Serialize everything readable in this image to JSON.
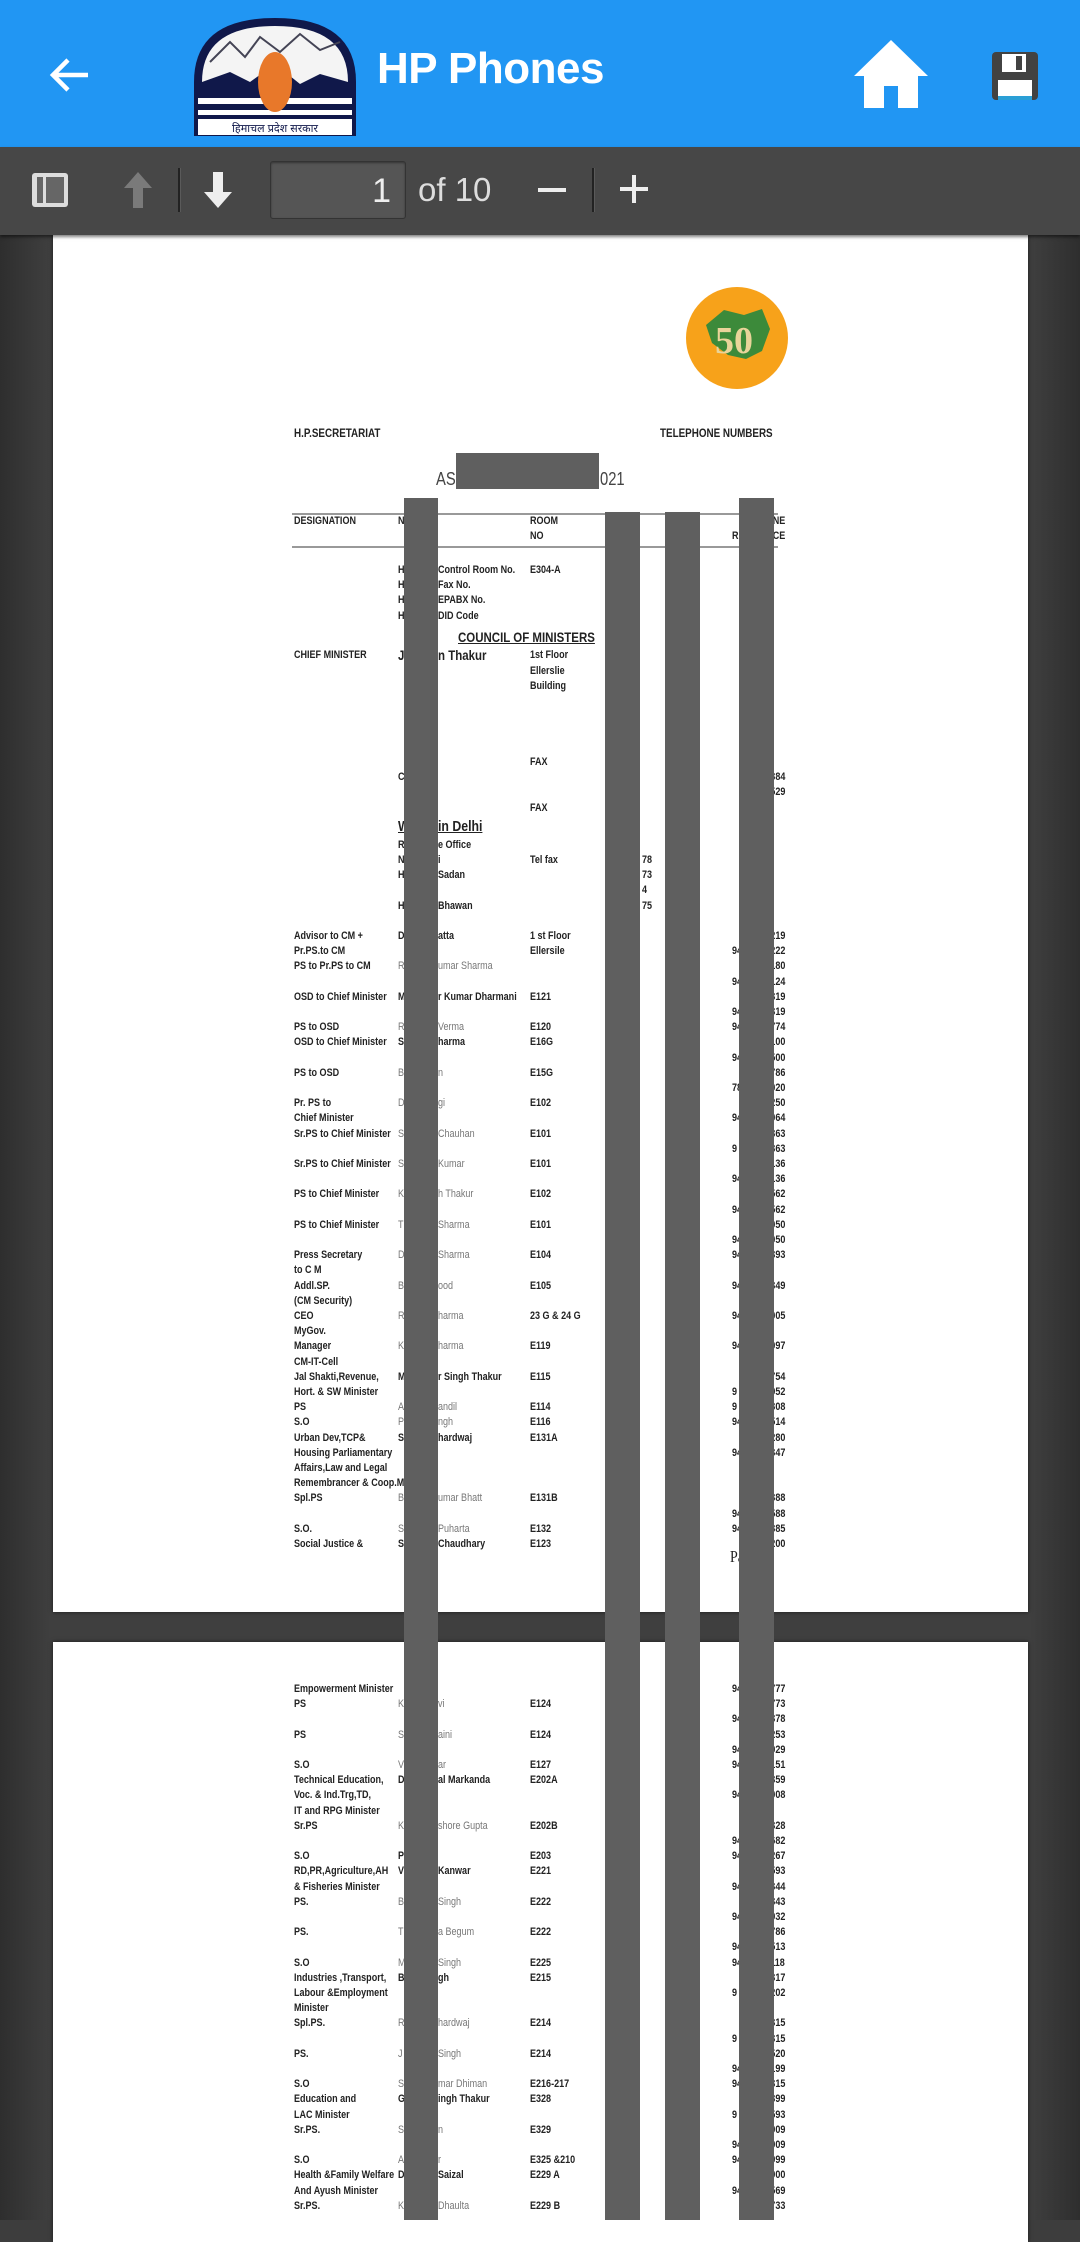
{
  "app": {
    "title": "HP Phones",
    "logo_text": "हिमाचल प्रदेश सरकार",
    "accent": "#2196f3"
  },
  "icons": {
    "back": "arrow-left-icon",
    "home": "home-icon",
    "save": "floppy-disk-icon",
    "sidebar": "sidebar-toggle-icon",
    "prev": "arrow-up-icon",
    "next": "arrow-down-icon",
    "zoom_out": "minus-icon",
    "zoom_in": "plus-icon"
  },
  "pdf_toolbar": {
    "current_page": "1",
    "of_pages": "of 10"
  },
  "document": {
    "left_header": "H.P.SECRETARIAT",
    "right_header": "TELEPHONE NUMBERS",
    "date_prefix": "AS",
    "date_suffix": "021",
    "columns": {
      "designation": "DESIGNATION",
      "name": "N",
      "room1": "ROOM",
      "room2": "NO",
      "phone1": "NE",
      "phone2a": "R",
      "phone2b": "CE"
    },
    "page_footer": "Pag",
    "page1_rows": [
      {
        "n1": "H",
        "n2": "Control Room No.",
        "r": "E304-A"
      },
      {
        "n1": "H",
        "n2": "Fax No."
      },
      {
        "n1": "H",
        "n2": "EPABX No."
      },
      {
        "n1": "H",
        "n2": "DID Code"
      },
      {
        "type": "heading",
        "text": "COUNCIL OF MINISTERS"
      },
      {
        "type": "cm",
        "d": "CHIEF MINISTER",
        "n1": "J",
        "n2": "n Thakur",
        "r": "1st Floor"
      },
      {
        "r": "Ellerslie"
      },
      {
        "r": "Building"
      },
      {},
      {},
      {},
      {},
      {
        "r": "FAX"
      },
      {
        "n1": "C",
        "p2": "384"
      },
      {
        "p2": "529"
      },
      {
        "r": "FAX"
      },
      {
        "type": "subheading",
        "n1": "W",
        "n2": "in Delhi"
      },
      {
        "n1": "R",
        "n2": "e Office"
      },
      {
        "n1": "N",
        "n2": "i",
        "r": "Tel fax",
        "t": "78"
      },
      {
        "n1": "H",
        "n2": "Sadan",
        "t": "73"
      },
      {
        "t": "4"
      },
      {
        "n1": "H",
        "n2": "Bhawan",
        "t": "75"
      },
      {},
      {
        "d": "Advisor to CM +",
        "n1": "D",
        "n2": "atta",
        "r": "1 st Floor",
        "p2": "219"
      },
      {
        "d": "Pr.PS.to CM",
        "r": "Ellersile",
        "p1": "94",
        "p2": "222"
      },
      {
        "d": "PS to Pr.PS to CM",
        "n1": "R",
        "n2": "umar Sharma",
        "light": true,
        "p2": "180"
      },
      {
        "p1": "94",
        "p2": "124"
      },
      {
        "d": "OSD to Chief Minister",
        "n1": "M",
        "n2": "r Kumar Dharmani",
        "r": "E121",
        "p2": "319"
      },
      {
        "p1": "94",
        "p2": "319"
      },
      {
        "d": "PS to OSD",
        "n1": "R",
        "n2": "Verma",
        "light": true,
        "r": "E120",
        "p1": "94",
        "p2": "774"
      },
      {
        "d": "OSD to Chief Minister",
        "n1": "S",
        "n2": "harma",
        "r": "E16G",
        "p2": "100"
      },
      {
        "p1": "94",
        "p2": "500"
      },
      {
        "d": "PS to OSD",
        "n1": "B",
        "n2": "n",
        "light": true,
        "r": "E15G",
        "p2": "786"
      },
      {
        "p1": "78",
        "p2": "020"
      },
      {
        "d": "Pr. PS to",
        "n1": "D",
        "n2": "gi",
        "light": true,
        "r": "E102",
        "p2": "250"
      },
      {
        "d": "Chief Minister",
        "p1": "94",
        "p2": "064"
      },
      {
        "d": "Sr.PS to Chief Minister",
        "n1": "S",
        "n2": "Chauhan",
        "light": true,
        "r": "E101",
        "p2": "363"
      },
      {
        "p1": "9",
        "p2": "363"
      },
      {
        "d": "Sr.PS to Chief Minister",
        "n1": "S",
        "n2": "Kumar",
        "light": true,
        "r": "E101",
        "p2": "136"
      },
      {
        "p1": "94",
        "p2": "136"
      },
      {
        "d": "PS to Chief Minister",
        "n1": "K",
        "n2": "h Thakur",
        "light": true,
        "r": "E102",
        "p2": "562"
      },
      {
        "p1": "94",
        "p2": "562"
      },
      {
        "d": "PS to Chief Minister",
        "n1": "T",
        "n2": "Sharma",
        "light": true,
        "r": "E101",
        "p2": "050"
      },
      {
        "p1": "94",
        "p2": "050"
      },
      {
        "d": "Press Secretary",
        "n1": "D",
        "n2": "Sharma",
        "light": true,
        "r": "E104",
        "p1": "94",
        "p2": "393"
      },
      {
        "d": "to C M"
      },
      {
        "d": "Addl.SP.",
        "n1": "B",
        "n2": "ood",
        "light": true,
        "r": "E105",
        "p1": "94",
        "p2": "349"
      },
      {
        "d": "(CM Security)"
      },
      {
        "d": "CEO",
        "n1": "R",
        "n2": "harma",
        "light": true,
        "r": "23 G & 24 G",
        "p1": "94",
        "p2": "005"
      },
      {
        "d": "MyGov."
      },
      {
        "d": "Manager",
        "n1": "K",
        "n2": "harma",
        "light": true,
        "r": "E119",
        "p1": "94",
        "p2": "097"
      },
      {
        "d": "CM-IT-Cell"
      },
      {
        "d": "Jal Shakti,Revenue,",
        "n1": "M",
        "n2": "r Singh Thakur",
        "r": "E115",
        "p2": "754"
      },
      {
        "d": "Hort. & SW Minister",
        "p1": "9",
        "p2": "952"
      },
      {
        "d": "PS",
        "n1": "A",
        "n2": "andil",
        "light": true,
        "r": "E114",
        "p1": "9",
        "p2": "308"
      },
      {
        "d": "S.O",
        "n1": "P",
        "n2": "ngh",
        "light": true,
        "r": "E116",
        "p1": "94",
        "p2": "514"
      },
      {
        "d": "Urban Dev,TCP&",
        "n1": "S",
        "n2": "hardwaj",
        "r": "E131A",
        "p2": "280"
      },
      {
        "d": "Housing Parliamentary",
        "p1": "94",
        "p2": "347"
      },
      {
        "d": "Affairs,Law and Legal"
      },
      {
        "d": "Remembrancer & Coop.M"
      },
      {
        "d": "Spl.PS",
        "n1": "B",
        "n2": "umar Bhatt",
        "light": true,
        "r": "E131B",
        "p2": "388"
      },
      {
        "p1": "94",
        "p2": "588"
      },
      {
        "d": "S.O.",
        "n1": "S",
        "n2": "Puharta",
        "light": true,
        "r": "E132",
        "p1": "94",
        "p2": "385"
      },
      {
        "d": "Social Justice &",
        "n1": "S",
        "n2": "Chaudhary",
        "r": "E123",
        "p2": "200"
      }
    ],
    "page2_rows": [
      {
        "d": "Empowerment Minister",
        "p1": "94",
        "p2": "777"
      },
      {
        "d": "PS",
        "n1": "K",
        "n2": "vi",
        "light": true,
        "r": "E124",
        "p2": "773"
      },
      {
        "p1": "94",
        "p2": "378"
      },
      {
        "d": "PS",
        "n1": "S",
        "n2": "aini",
        "light": true,
        "r": "E124",
        "p2": "253"
      },
      {
        "p1": "94",
        "p2": "929"
      },
      {
        "d": "S.O",
        "n1": "V",
        "n2": "ar",
        "light": true,
        "r": "E127",
        "p1": "94",
        "p2": "151"
      },
      {
        "d": "Technical Education,",
        "n1": "D",
        "n2": "al Markanda",
        "r": "E202A",
        "p2": "359"
      },
      {
        "d": "Voc. & Ind.Trg,TD,",
        "p1": "94",
        "p2": "008"
      },
      {
        "d": "IT and RPG Minister"
      },
      {
        "d": "Sr.PS",
        "n1": "K",
        "n2": "shore Gupta",
        "light": true,
        "r": "E202B",
        "p2": "328"
      },
      {
        "p1": "94",
        "p2": "682"
      },
      {
        "d": "S.O",
        "n1": "P",
        "r": "E203",
        "p1": "94",
        "p2": "267"
      },
      {
        "d": "RD,PR,Agriculture,AH",
        "n1": "V",
        "n2": "Kanwar",
        "r": "E221",
        "p2": "593"
      },
      {
        "d": "& Fisheries  Minister",
        "p1": "94",
        "p2": "344"
      },
      {
        "d": "PS.",
        "n1": "B",
        "n2": "Singh",
        "light": true,
        "r": "E222",
        "p2": "343"
      },
      {
        "p1": "94",
        "p2": "932"
      },
      {
        "d": "PS.",
        "n1": "T",
        "n2": "a Begum",
        "light": true,
        "r": "E222",
        "p2": "786"
      },
      {
        "p1": "94",
        "p2": "513"
      },
      {
        "d": "S.O",
        "n1": "M",
        "n2": "Singh",
        "light": true,
        "r": "E225",
        "p1": "94",
        "p2": "118"
      },
      {
        "d": "Industries ,Transport,",
        "n1": "Bik",
        "n2": "gh",
        "r": "E215",
        "p2": "317"
      },
      {
        "d": "Labour &Employment",
        "p1": "9",
        "p2": "202"
      },
      {
        "d": "Minister"
      },
      {
        "d": "Spl.PS.",
        "n1": "R",
        "n2": "hardwaj",
        "light": true,
        "r": "E214",
        "p2": "315"
      },
      {
        "p1": "9",
        "p2": "315"
      },
      {
        "d": "PS.",
        "n1": "J",
        "n2": "Singh",
        "light": true,
        "r": "E214",
        "p2": "520"
      },
      {
        "p1": "94",
        "p2": "199"
      },
      {
        "d": "S.O",
        "n1": "S",
        "n2": "mar Dhiman",
        "light": true,
        "r": "E216-217",
        "p1": "94",
        "p2": "315"
      },
      {
        "d": "Education and",
        "n1": "G",
        "n2": "ingh Thakur",
        "r": "E328",
        "p2": "399"
      },
      {
        "d": "LAC  Minister",
        "p1": "9",
        "p2": "593"
      },
      {
        "d": "Sr.PS.",
        "n1": "S",
        "n2": "n",
        "light": true,
        "r": "E329",
        "p2": "909"
      },
      {
        "p1": "94",
        "p2": "909"
      },
      {
        "d": "S.O",
        "n1": "A",
        "n2": "r",
        "light": true,
        "r": "E325 &210",
        "p1": "94",
        "p2": "999"
      },
      {
        "d": "Health &Family Welfare",
        "n1": "D",
        "n2": "Saizal",
        "r": "E229 A",
        "p2": "900"
      },
      {
        "d": "And Ayush Minister",
        "p1": "94",
        "p2": "569"
      },
      {
        "d": "Sr.PS.",
        "n1": "K",
        "n2": "Dhaulta",
        "light": true,
        "r": "E229 B",
        "p2": "733"
      }
    ]
  }
}
